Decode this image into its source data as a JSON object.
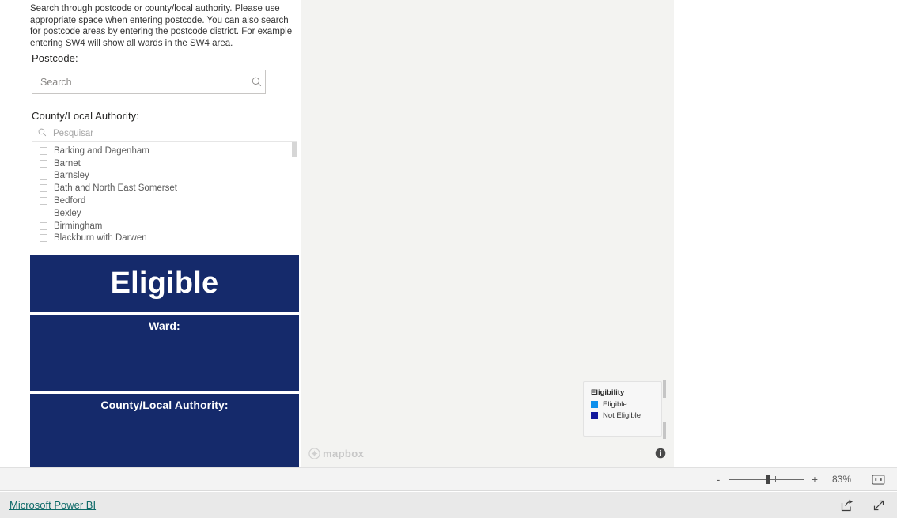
{
  "panel": {
    "intro_text": "Search through postcode or county/local authority. Please use appropriate space when entering postcode. You can also search for postcode areas by entering the postcode district. For example entering SW4 will show all wards in the SW4 area.",
    "postcode_label": "Postcode:",
    "postcode_placeholder": "Search",
    "postcode_value": "",
    "search_icon": "search-icon",
    "eraser_icon": "eraser-icon",
    "cla_label": "County/Local Authority:",
    "cla_search_placeholder": "Pesquisar",
    "cla_search_value": "",
    "cla_items": [
      "Barking and Dagenham",
      "Barnet",
      "Barnsley",
      "Bath and North East Somerset",
      "Bedford",
      "Bexley",
      "Birmingham",
      "Blackburn with Darwen"
    ]
  },
  "cards": {
    "eligibility_status": "Eligible",
    "ward_title": "Ward:",
    "ward_value": "",
    "cla_title": "County/Local Authority:",
    "cla_value": "",
    "navy": "#152a6b"
  },
  "map": {
    "attribution": "mapbox",
    "info_icon": "info-icon",
    "legend": {
      "title": "Eligibility",
      "entries": [
        {
          "label": "Eligible",
          "color": "#0d8fec"
        },
        {
          "label": "Not Eligible",
          "color": "#12189c"
        }
      ]
    }
  },
  "zoom_bar": {
    "minus_label": "-",
    "plus_label": "+",
    "percent": "83%",
    "fit_icon": "fit-to-page-icon"
  },
  "status_bar": {
    "brand_link": "Microsoft Power BI",
    "share_icon": "share-icon",
    "fullscreen_icon": "fullscreen-icon"
  }
}
